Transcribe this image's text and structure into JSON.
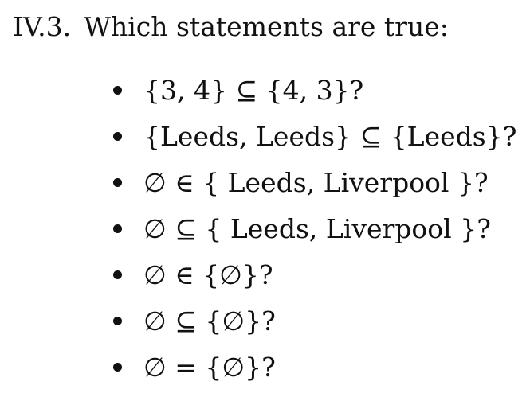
{
  "question": {
    "number": "IV.3.",
    "text": "Which statements are true:"
  },
  "statements": [
    "{3, 4} ⊆ {4, 3}?",
    "{Leeds, Leeds} ⊆ {Leeds}?",
    "∅ ∈ { Leeds, Liverpool }?",
    "∅ ⊆ { Leeds, Liverpool }?",
    "∅ ∈ {∅}?",
    "∅ ⊆ {∅}?",
    "∅ = {∅}?"
  ]
}
